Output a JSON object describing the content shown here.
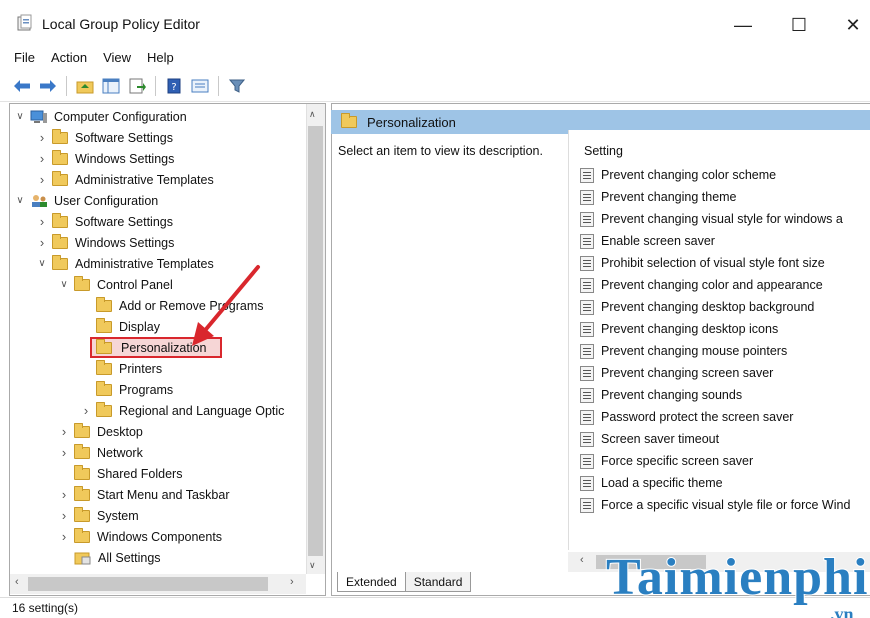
{
  "window": {
    "title": "Local Group Policy Editor",
    "minimize": "—",
    "maximize": "☐",
    "close": "✕"
  },
  "menu": [
    "File",
    "Action",
    "View",
    "Help"
  ],
  "tree": {
    "items": [
      {
        "label": "Computer Configuration",
        "level": 0,
        "expander": "open",
        "icon": "computer-icon"
      },
      {
        "label": "Software Settings",
        "level": 1,
        "expander": "closed",
        "icon": "folder-icon"
      },
      {
        "label": "Windows Settings",
        "level": 1,
        "expander": "closed",
        "icon": "folder-icon"
      },
      {
        "label": "Administrative Templates",
        "level": 1,
        "expander": "closed",
        "icon": "folder-icon"
      },
      {
        "label": "User Configuration",
        "level": 0,
        "expander": "open",
        "icon": "user-icon"
      },
      {
        "label": "Software Settings",
        "level": 1,
        "expander": "closed",
        "icon": "folder-icon"
      },
      {
        "label": "Windows Settings",
        "level": 1,
        "expander": "closed",
        "icon": "folder-icon"
      },
      {
        "label": "Administrative Templates",
        "level": 1,
        "expander": "open",
        "icon": "folder-icon"
      },
      {
        "label": "Control Panel",
        "level": 2,
        "expander": "open",
        "icon": "folder-icon"
      },
      {
        "label": "Add or Remove Programs",
        "level": 3,
        "expander": "none",
        "icon": "folder-icon"
      },
      {
        "label": "Display",
        "level": 3,
        "expander": "none",
        "icon": "folder-icon"
      },
      {
        "label": "Personalization",
        "level": 3,
        "expander": "none",
        "icon": "folder-icon",
        "selected": true
      },
      {
        "label": "Printers",
        "level": 3,
        "expander": "none",
        "icon": "folder-icon"
      },
      {
        "label": "Programs",
        "level": 3,
        "expander": "none",
        "icon": "folder-icon"
      },
      {
        "label": "Regional and Language Optic",
        "level": 3,
        "expander": "closed",
        "icon": "folder-icon"
      },
      {
        "label": "Desktop",
        "level": 2,
        "expander": "closed",
        "icon": "folder-icon"
      },
      {
        "label": "Network",
        "level": 2,
        "expander": "closed",
        "icon": "folder-icon"
      },
      {
        "label": "Shared Folders",
        "level": 2,
        "expander": "none",
        "icon": "folder-icon"
      },
      {
        "label": "Start Menu and Taskbar",
        "level": 2,
        "expander": "closed",
        "icon": "folder-icon"
      },
      {
        "label": "System",
        "level": 2,
        "expander": "closed",
        "icon": "folder-icon"
      },
      {
        "label": "Windows Components",
        "level": 2,
        "expander": "closed",
        "icon": "folder-icon"
      },
      {
        "label": "All Settings",
        "level": 2,
        "expander": "none",
        "icon": "all-settings-icon"
      }
    ]
  },
  "details": {
    "header": "Personalization",
    "description": "Select an item to view its description.",
    "column_header": "Setting",
    "settings": [
      "Prevent changing color scheme",
      "Prevent changing theme",
      "Prevent changing visual style for windows a",
      "Enable screen saver",
      "Prohibit selection of visual style font size",
      "Prevent changing color and appearance",
      "Prevent changing desktop background",
      "Prevent changing desktop icons",
      "Prevent changing mouse pointers",
      "Prevent changing screen saver",
      "Prevent changing sounds",
      "Password protect the screen saver",
      "Screen saver timeout",
      "Force specific screen saver",
      "Load a specific theme",
      "Force a specific visual style file or force Wind"
    ]
  },
  "tabs": [
    "Extended",
    "Standard"
  ],
  "status": "16 setting(s)",
  "watermark": {
    "main": "Taimienphi",
    "suffix": ".vn"
  },
  "colors": {
    "selection_outline": "#d9272d",
    "header_bg": "#9ec4e6",
    "watermark": "#2a7fc1"
  }
}
